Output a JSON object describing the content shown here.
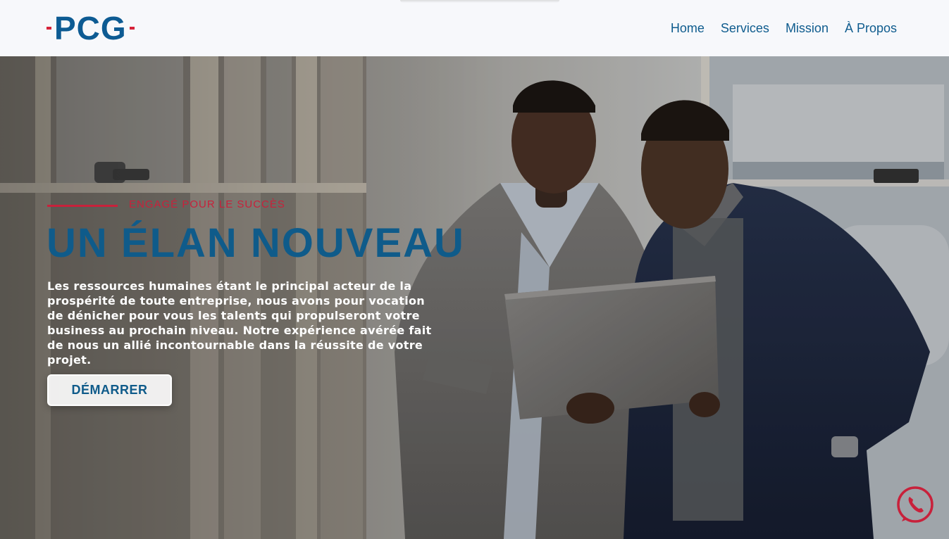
{
  "header": {
    "logo_text": "PCG",
    "nav": [
      {
        "label": "Home"
      },
      {
        "label": "Services"
      },
      {
        "label": "Mission"
      },
      {
        "label": "À Propos"
      }
    ]
  },
  "hero": {
    "eyebrow": "ENGAGÉ POUR LE SUCCÈS",
    "headline": "UN ÉLAN NOUVEAU",
    "body": "Les ressources humaines étant le principal acteur de la prospérité de toute entreprise, nous avons pour vocation de dénicher pour vous les talents qui propulseront votre business au prochain niveau. Notre expérience avérée fait de nous un allié incontournable dans la réussite de votre projet.",
    "cta_label": "DÉMARRER"
  },
  "floating": {
    "chat_icon": "phone-chat-icon"
  },
  "colors": {
    "brand_blue": "#0f5b8a",
    "brand_red": "#c8213b",
    "header_bg": "#f7f8fb"
  }
}
